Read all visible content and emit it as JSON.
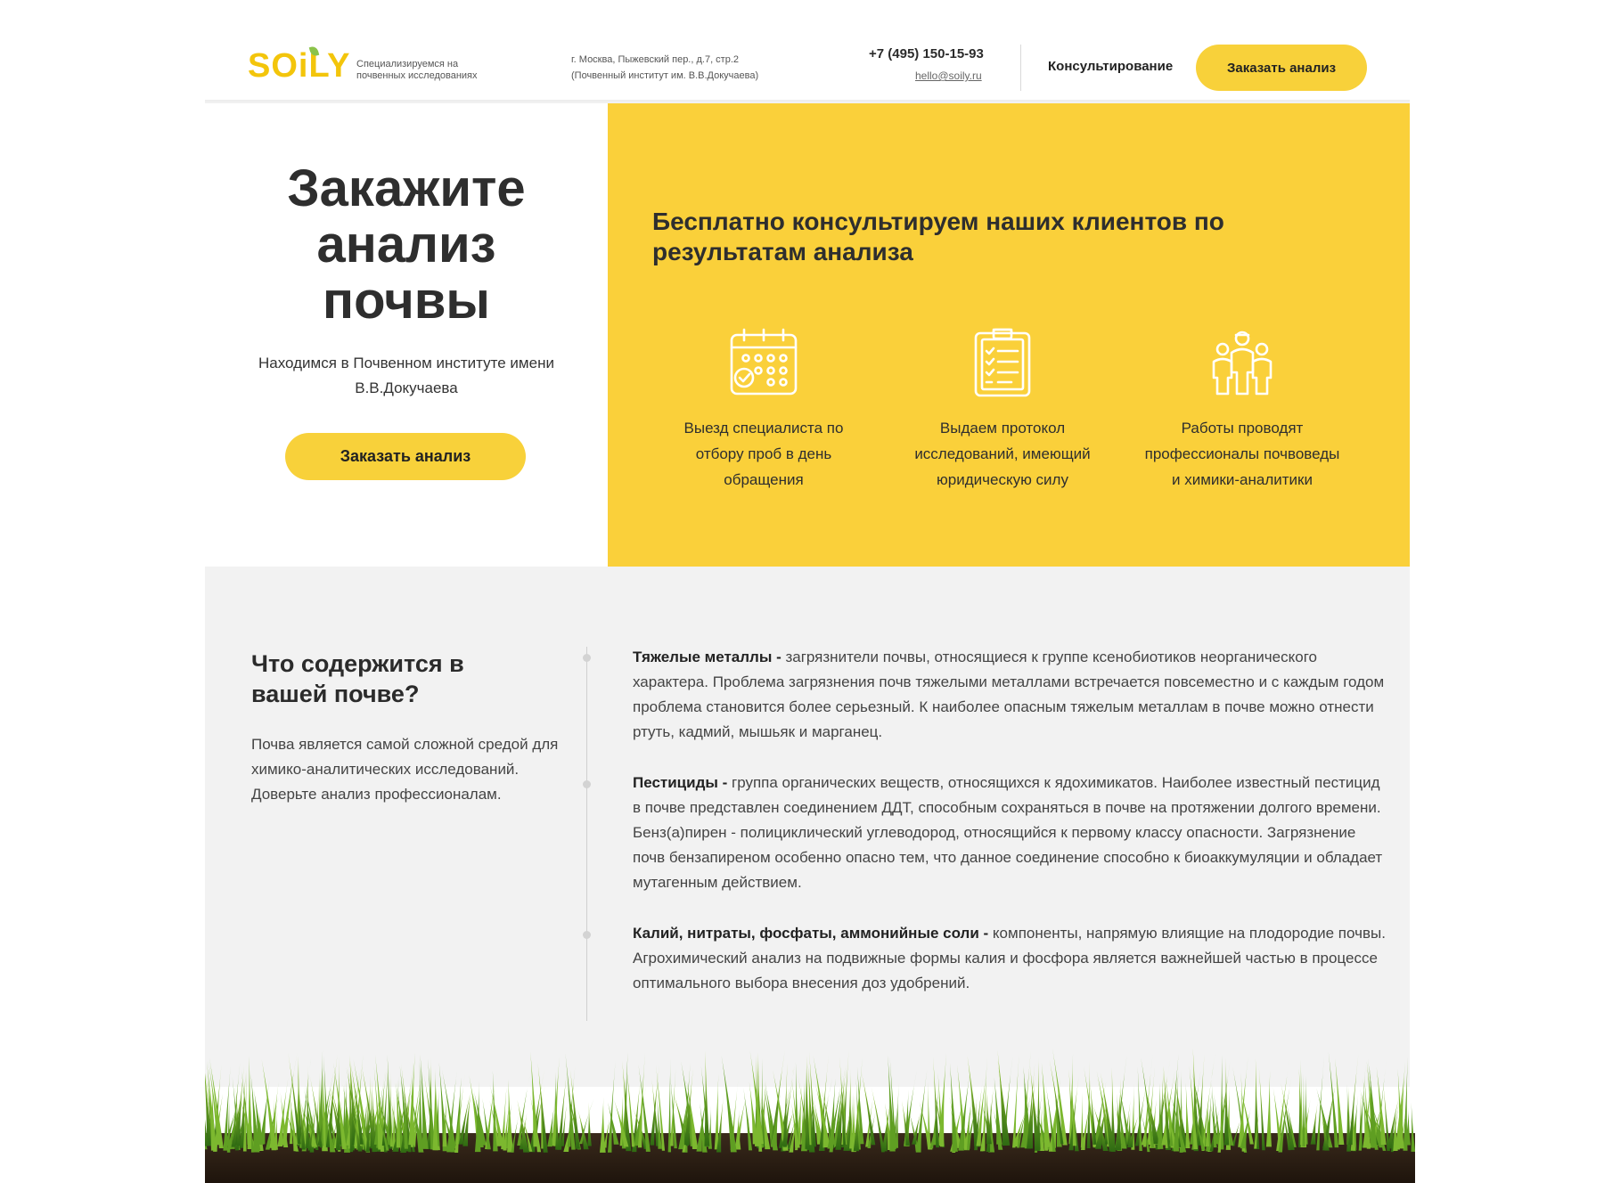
{
  "header": {
    "logo": "SOiLY",
    "tagline": "Специализируемся на почвенных исследованиях",
    "address_line1": "г. Москва, Пыжевский пер., д.7, стр.2",
    "address_line2": "(Почвенный институт им. В.В.Докучаева)",
    "phone": "+7 (495) 150-15-93",
    "email": "hello@soily.ru",
    "nav_consult": "Консультирование",
    "order_button": "Заказать анализ"
  },
  "hero": {
    "title_line1": "Закажите",
    "title_line2": "анализ",
    "title_line3": "почвы",
    "subtitle": "Находимся в Почвенном институте имени В.В.Докучаева",
    "button": "Заказать анализ"
  },
  "benefits": {
    "title": "Бесплатно консультируем наших клиентов по результатам анализа",
    "items": [
      {
        "icon": "calendar-icon",
        "text": "Выезд специалиста по отбору проб в день обращения"
      },
      {
        "icon": "clipboard-icon",
        "text": "Выдаем протокол исследований, имеющий юридическую силу"
      },
      {
        "icon": "team-icon",
        "text": "Работы проводят профессионалы почвоведы и химики-аналитики"
      }
    ]
  },
  "content": {
    "title": "Что содержится в вашей почве?",
    "description": "Почва является самой сложной средой для химико-аналитических исследований. Доверьте анализ профессионалам.",
    "items": [
      {
        "term": "Тяжелые металлы -",
        "text": " загрязнители почвы, относящиеся к группе ксенобиотиков неорганического характера. Проблема загрязнения почв тяжелыми металлами встречается повсеместно и с каждым годом проблема становится более серьезный. К наиболее опасным тяжелым металлам в почве можно отнести ртуть, кадмий, мышьяк и марганец."
      },
      {
        "term": "Пестициды -",
        "text": " группа органических веществ, относящихся к ядохимикатов. Наиболее известный пестицид в почве представлен соединением ДДТ, способным сохраняться в почве на протяжении долгого времени. Бенз(а)пирен - полициклический углеводород, относящийся к первому классу опасности. Загрязнение почв бензапиреном особенно опасно тем, что данное соединение способно к биоаккумуляции и обладает мутагенным действием."
      },
      {
        "term": "Калий, нитраты, фосфаты, аммонийные соли -",
        "text": " компоненты, напрямую влиящие на плодородие почвы. Агрохимический анализ на подвижные формы калия и фосфора является важнейшей частью в процессе оптимального выбора внесения доз удобрений."
      }
    ]
  },
  "colors": {
    "accent": "#fad03a",
    "button": "#f8d13a",
    "section_bg": "#f2f2f2"
  }
}
